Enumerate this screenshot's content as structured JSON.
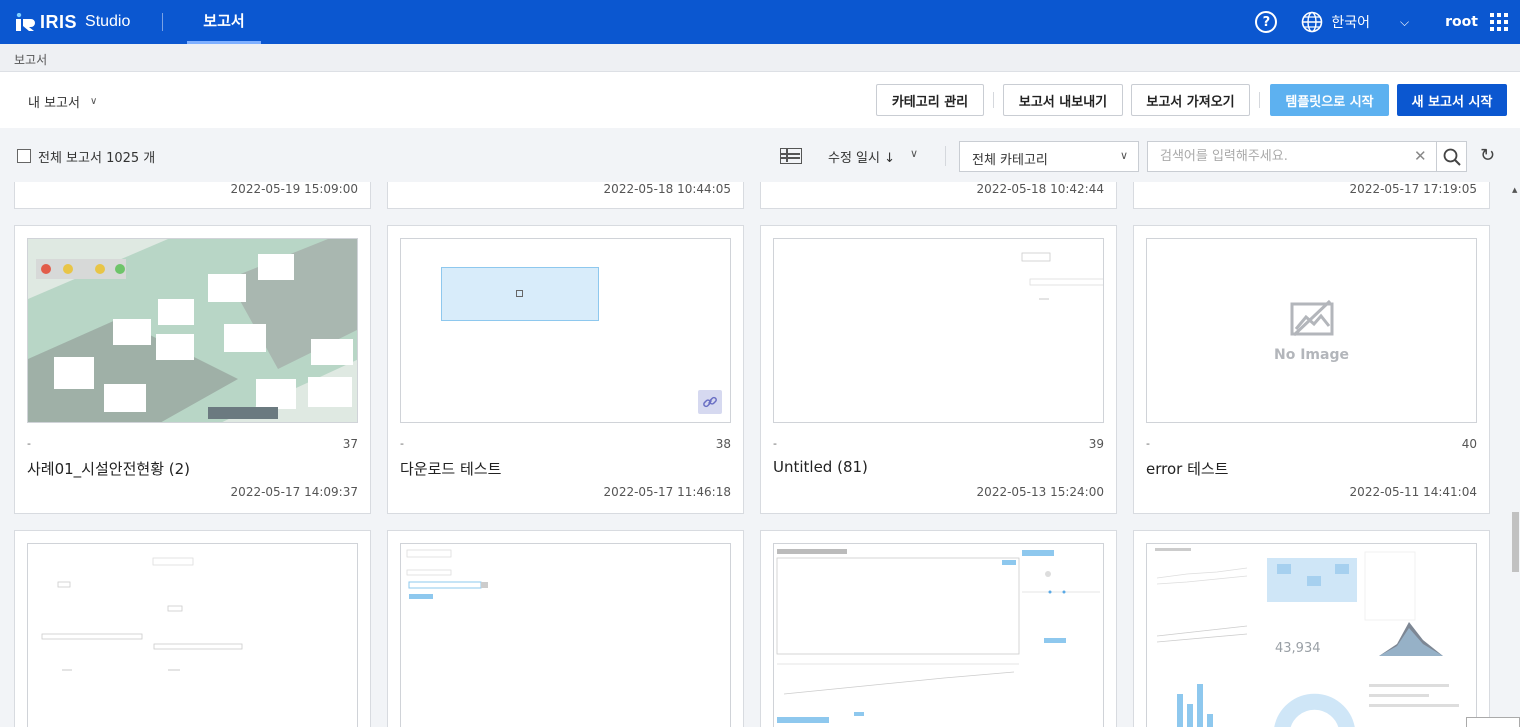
{
  "header": {
    "brand": "IRIS",
    "studio": "Studio",
    "active_tab": "보고서",
    "help_icon": "?",
    "language": "한국어",
    "user": "root"
  },
  "breadcrumb": "보고서",
  "toolbar": {
    "scope": "내 보고서",
    "category_manage": "카테고리 관리",
    "export": "보고서 내보내기",
    "import": "보고서 가져오기",
    "start_template": "템플릿으로 시작",
    "new_report": "새 보고서 시작"
  },
  "filters": {
    "total_label": "전체 보고서 1025 개",
    "sort": "수정 일시 ↓",
    "category": "전체 카테고리",
    "search_placeholder": "검색어를 입력해주세요."
  },
  "cards_top_row_dates": [
    "2022-05-19 15:09:00",
    "2022-05-18 10:44:05",
    "2022-05-18 10:42:44",
    "2022-05-17 17:19:05"
  ],
  "cards": [
    {
      "category": "-",
      "number": "37",
      "title": "사례01_시설안전현황 (2)",
      "date": "2022-05-17 14:09:37",
      "thumb": "factory"
    },
    {
      "category": "-",
      "number": "38",
      "title": "다운로드 테스트",
      "date": "2022-05-17 11:46:18",
      "thumb": "box"
    },
    {
      "category": "-",
      "number": "39",
      "title": "Untitled (81)",
      "date": "2022-05-13 15:24:00",
      "thumb": "sparse"
    },
    {
      "category": "-",
      "number": "40",
      "title": "error 테스트",
      "date": "2022-05-11 14:41:04",
      "thumb": "noimage"
    }
  ],
  "no_image_text": "No Image",
  "dashboard_kpi": "43,934",
  "icons": {
    "help": "question-circle-icon",
    "language": "globe-icon",
    "apps": "grid-icon",
    "list_view": "list-view-icon",
    "search": "search-icon",
    "clear": "close-icon",
    "refresh": "refresh-icon",
    "link": "link-icon",
    "no_image": "image-placeholder-icon"
  },
  "colors": {
    "brand": "#0b57d0",
    "template_button": "#5db1f0"
  }
}
